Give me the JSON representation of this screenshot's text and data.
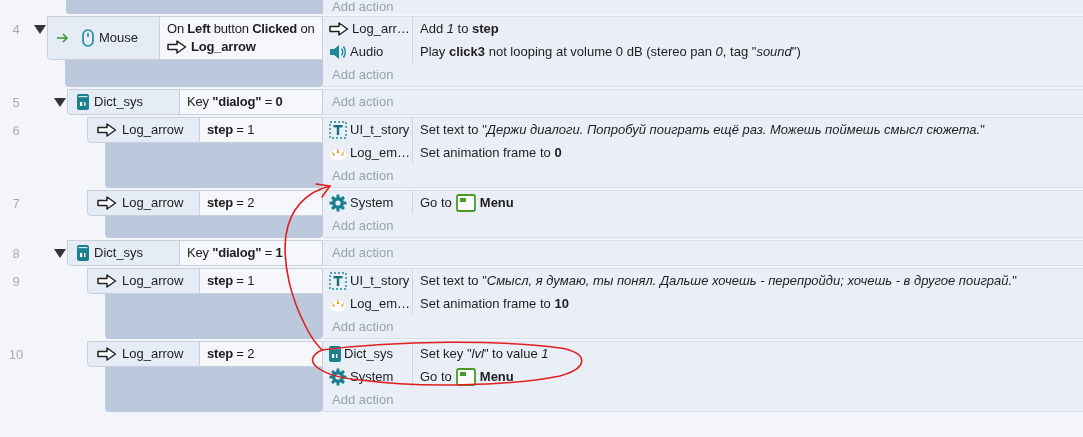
{
  "top_add_action": "Add action",
  "events": [
    {
      "number": "4",
      "expanded": true,
      "trigger": true,
      "conditions": [
        {
          "kind": "mouse",
          "object": "Mouse",
          "text": "On **Left** button **Clicked** on",
          "param": {
            "kind": "arrow",
            "text": "Log_arrow"
          }
        }
      ],
      "actions": [
        {
          "kind": "arrow",
          "object": "Log_arr…",
          "text": "Add *1* to **step**"
        },
        {
          "kind": "audio",
          "object": "Audio",
          "text": "Play **click3** not looping at volume 0 dB (stereo pan *0*, tag \"*sound*\")"
        }
      ],
      "add_action": "Add action",
      "children": [
        {
          "number": "5",
          "expanded": true,
          "conditions": [
            {
              "kind": "dictionary",
              "object": "Dict_sys",
              "text": "Key **\"dialog\"** = **0**"
            }
          ],
          "add_action": "Add action",
          "children": [
            {
              "number": "6",
              "conditions": [
                {
                  "kind": "arrow",
                  "object": "Log_arrow",
                  "text": "**step** = 1"
                }
              ],
              "actions": [
                {
                  "kind": "text",
                  "object": "UI_t_story",
                  "text": "Set text to \"*Держи диалоги. Попробуй поиграть ещё раз. Можешь поймешь смысл сюжета.*\""
                },
                {
                  "kind": "emitter",
                  "object": "Log_em…",
                  "text": "Set animation frame to **0**"
                }
              ],
              "add_action": "Add action"
            },
            {
              "number": "7",
              "conditions": [
                {
                  "kind": "arrow",
                  "object": "Log_arrow",
                  "text": "**step** = 2"
                }
              ],
              "actions": [
                {
                  "kind": "system",
                  "object": "System",
                  "text": "Go to",
                  "param": {
                    "kind": "layout",
                    "text": "Menu"
                  }
                }
              ],
              "add_action": "Add action"
            }
          ]
        },
        {
          "number": "8",
          "expanded": true,
          "conditions": [
            {
              "kind": "dictionary",
              "object": "Dict_sys",
              "text": "Key **\"dialog\"** = **1**"
            }
          ],
          "add_action": "Add action",
          "children": [
            {
              "number": "9",
              "conditions": [
                {
                  "kind": "arrow",
                  "object": "Log_arrow",
                  "text": "**step** = 1"
                }
              ],
              "actions": [
                {
                  "kind": "text",
                  "object": "UI_t_story",
                  "text": "Set text to \"*Смысл, я думаю, ты понял. Дальше хочешь - перепройди; хочешь - в другое поиграй.*\""
                },
                {
                  "kind": "emitter",
                  "object": "Log_em…",
                  "text": "Set animation frame to **10**"
                }
              ],
              "add_action": "Add action"
            },
            {
              "number": "10",
              "conditions": [
                {
                  "kind": "arrow",
                  "object": "Log_arrow",
                  "text": "**step** = 2"
                }
              ],
              "actions": [
                {
                  "kind": "dictionary",
                  "object": "Dict_sys",
                  "text": "Set key \"*lvl*\" to value *1*"
                },
                {
                  "kind": "system",
                  "object": "System",
                  "text": "Go to",
                  "param": {
                    "kind": "layout",
                    "text": "Menu"
                  }
                }
              ],
              "add_action": "Add action"
            }
          ]
        }
      ]
    }
  ]
}
